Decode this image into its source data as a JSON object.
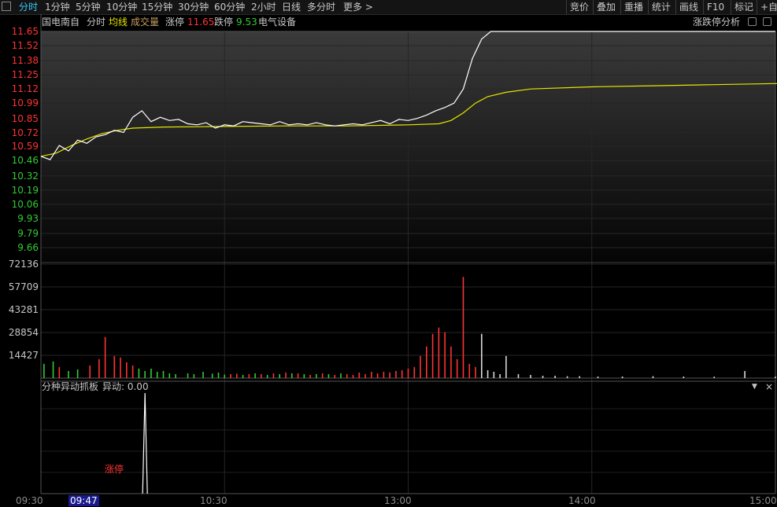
{
  "toolbar": {
    "tabs": [
      {
        "label": "分时",
        "active": true
      },
      {
        "label": "1分钟"
      },
      {
        "label": "5分钟"
      },
      {
        "label": "10分钟"
      },
      {
        "label": "15分钟"
      },
      {
        "label": "30分钟"
      },
      {
        "label": "60分钟"
      },
      {
        "label": "2小时"
      },
      {
        "label": "日线"
      },
      {
        "label": "多分时"
      },
      {
        "label": "更多 >"
      }
    ],
    "right_buttons": [
      "竞价",
      "叠加",
      "重播",
      "统计",
      "画线",
      "F10",
      "标记",
      "+自"
    ]
  },
  "header": {
    "stock_name": "国电南自",
    "mode": "分时",
    "avg_line": "均线",
    "volume": "成交量",
    "limit_up_label": "涨停",
    "limit_up_value": "11.65",
    "limit_down_label": "跌停",
    "limit_down_value": "9.53",
    "sector": "电气设备",
    "analysis_label": "涨跌停分析"
  },
  "indicator_panel": {
    "title": "分种异动抓板",
    "value_label": "异动: 0.00",
    "event_label": "涨停"
  },
  "colors": {
    "up": "#ff3333",
    "down": "#33cc33",
    "price_line": "#ffffff",
    "avg_line": "#e6e600",
    "highlight": "#33ccff"
  },
  "chart_data": {
    "type": "line",
    "price_axis": {
      "ticks": [
        "11.65",
        "11.52",
        "11.38",
        "11.25",
        "11.12",
        "10.99",
        "10.85",
        "10.72",
        "10.59",
        "10.46",
        "10.32",
        "10.19",
        "10.06",
        "9.93",
        "9.79",
        "9.66"
      ],
      "ylim": [
        9.6,
        11.7
      ]
    },
    "volume_axis": {
      "ticks": [
        "72136",
        "57709",
        "43281",
        "28854",
        "14427"
      ],
      "ylim": [
        0,
        72136
      ]
    },
    "time_ticks": [
      "09:30",
      "10:30",
      "13:00",
      "14:00",
      "15:00"
    ],
    "cursor_time": "09:47",
    "price_series": [
      [
        0,
        10.5
      ],
      [
        3,
        10.47
      ],
      [
        6,
        10.6
      ],
      [
        9,
        10.55
      ],
      [
        12,
        10.65
      ],
      [
        15,
        10.62
      ],
      [
        18,
        10.68
      ],
      [
        21,
        10.7
      ],
      [
        24,
        10.74
      ],
      [
        27,
        10.72
      ],
      [
        30,
        10.86
      ],
      [
        33,
        10.92
      ],
      [
        36,
        10.82
      ],
      [
        39,
        10.86
      ],
      [
        42,
        10.83
      ],
      [
        45,
        10.84
      ],
      [
        48,
        10.8
      ],
      [
        51,
        10.79
      ],
      [
        54,
        10.81
      ],
      [
        57,
        10.76
      ],
      [
        60,
        10.79
      ],
      [
        63,
        10.78
      ],
      [
        66,
        10.82
      ],
      [
        69,
        10.81
      ],
      [
        72,
        10.8
      ],
      [
        75,
        10.79
      ],
      [
        78,
        10.82
      ],
      [
        81,
        10.79
      ],
      [
        84,
        10.8
      ],
      [
        87,
        10.79
      ],
      [
        90,
        10.81
      ],
      [
        93,
        10.79
      ],
      [
        96,
        10.78
      ],
      [
        99,
        10.79
      ],
      [
        102,
        10.8
      ],
      [
        105,
        10.79
      ],
      [
        108,
        10.81
      ],
      [
        111,
        10.83
      ],
      [
        114,
        10.8
      ],
      [
        117,
        10.84
      ],
      [
        120,
        10.83
      ],
      [
        123,
        10.85
      ],
      [
        126,
        10.88
      ],
      [
        129,
        10.92
      ],
      [
        132,
        10.95
      ],
      [
        135,
        10.99
      ],
      [
        138,
        11.12
      ],
      [
        141,
        11.4
      ],
      [
        144,
        11.58
      ],
      [
        147,
        11.65
      ],
      [
        160,
        11.65
      ],
      [
        240,
        11.65
      ]
    ],
    "avg_series": [
      [
        0,
        10.5
      ],
      [
        5,
        10.53
      ],
      [
        10,
        10.6
      ],
      [
        15,
        10.66
      ],
      [
        20,
        10.71
      ],
      [
        25,
        10.74
      ],
      [
        30,
        10.76
      ],
      [
        40,
        10.77
      ],
      [
        60,
        10.775
      ],
      [
        80,
        10.78
      ],
      [
        100,
        10.78
      ],
      [
        120,
        10.79
      ],
      [
        130,
        10.8
      ],
      [
        134,
        10.83
      ],
      [
        138,
        10.9
      ],
      [
        142,
        10.99
      ],
      [
        146,
        11.05
      ],
      [
        152,
        11.09
      ],
      [
        160,
        11.12
      ],
      [
        180,
        11.14
      ],
      [
        200,
        11.15
      ],
      [
        220,
        11.16
      ],
      [
        240,
        11.17
      ],
      [
        260,
        11.18
      ],
      [
        280,
        11.19
      ],
      [
        300,
        11.2
      ],
      [
        320,
        11.205
      ],
      [
        340,
        11.21
      ],
      [
        360,
        11.215
      ],
      [
        369,
        11.22
      ],
      [
        372,
        11.25
      ],
      [
        390,
        11.26
      ],
      [
        420,
        11.265
      ],
      [
        445,
        11.27
      ]
    ],
    "volume_bars": [
      [
        1,
        9000,
        "down"
      ],
      [
        4,
        10500,
        "down"
      ],
      [
        6,
        7000,
        "up"
      ],
      [
        9,
        4500,
        "down"
      ],
      [
        12,
        5500,
        "down"
      ],
      [
        16,
        8000,
        "up"
      ],
      [
        19,
        12000,
        "up"
      ],
      [
        21,
        26000,
        "up"
      ],
      [
        24,
        14000,
        "up"
      ],
      [
        26,
        13000,
        "up"
      ],
      [
        28,
        10000,
        "up"
      ],
      [
        30,
        8000,
        "up"
      ],
      [
        32,
        6000,
        "down"
      ],
      [
        34,
        4500,
        "down"
      ],
      [
        36,
        6000,
        "down"
      ],
      [
        38,
        4000,
        "down"
      ],
      [
        40,
        4500,
        "down"
      ],
      [
        42,
        3000,
        "down"
      ],
      [
        44,
        2500,
        "down"
      ],
      [
        48,
        3000,
        "down"
      ],
      [
        50,
        2500,
        "down"
      ],
      [
        53,
        4000,
        "down"
      ],
      [
        56,
        2800,
        "down"
      ],
      [
        58,
        3500,
        "down"
      ],
      [
        60,
        2200,
        "down"
      ],
      [
        62,
        2500,
        "up"
      ],
      [
        64,
        2800,
        "up"
      ],
      [
        66,
        2000,
        "down"
      ],
      [
        68,
        2500,
        "up"
      ],
      [
        70,
        3000,
        "down"
      ],
      [
        72,
        2500,
        "up"
      ],
      [
        74,
        2000,
        "down"
      ],
      [
        76,
        3000,
        "up"
      ],
      [
        78,
        2500,
        "down"
      ],
      [
        80,
        3500,
        "up"
      ],
      [
        82,
        3000,
        "down"
      ],
      [
        84,
        3000,
        "up"
      ],
      [
        86,
        2500,
        "down"
      ],
      [
        88,
        2000,
        "up"
      ],
      [
        90,
        2500,
        "down"
      ],
      [
        92,
        3000,
        "up"
      ],
      [
        94,
        2500,
        "down"
      ],
      [
        96,
        2000,
        "up"
      ],
      [
        98,
        3000,
        "down"
      ],
      [
        100,
        2500,
        "up"
      ],
      [
        102,
        2000,
        "up"
      ],
      [
        104,
        3500,
        "up"
      ],
      [
        106,
        2500,
        "up"
      ],
      [
        108,
        4000,
        "up"
      ],
      [
        110,
        3000,
        "up"
      ],
      [
        112,
        4000,
        "up"
      ],
      [
        114,
        3500,
        "up"
      ],
      [
        116,
        4500,
        "up"
      ],
      [
        118,
        5000,
        "up"
      ],
      [
        120,
        6000,
        "up"
      ],
      [
        122,
        7000,
        "up"
      ],
      [
        124,
        14000,
        "up"
      ],
      [
        126,
        20000,
        "up"
      ],
      [
        128,
        28000,
        "up"
      ],
      [
        130,
        32000,
        "up"
      ],
      [
        132,
        29000,
        "up"
      ],
      [
        134,
        20000,
        "up"
      ],
      [
        136,
        12000,
        "up"
      ],
      [
        138,
        64000,
        "up"
      ],
      [
        140,
        9000,
        "up"
      ],
      [
        142,
        7000,
        "up"
      ],
      [
        144,
        28000,
        "neutral"
      ],
      [
        146,
        5000,
        "neutral"
      ],
      [
        148,
        4000,
        "neutral"
      ],
      [
        150,
        2500,
        "neutral"
      ],
      [
        152,
        14000,
        "neutral"
      ],
      [
        156,
        2500,
        "neutral"
      ],
      [
        160,
        2000,
        "neutral"
      ],
      [
        164,
        1500,
        "neutral"
      ],
      [
        168,
        1500,
        "neutral"
      ],
      [
        172,
        1200,
        "neutral"
      ],
      [
        176,
        1200,
        "neutral"
      ],
      [
        182,
        1000,
        "neutral"
      ],
      [
        190,
        1000,
        "neutral"
      ],
      [
        200,
        1200,
        "neutral"
      ],
      [
        210,
        1000,
        "neutral"
      ],
      [
        220,
        900,
        "neutral"
      ],
      [
        230,
        4500,
        "neutral"
      ],
      [
        240,
        900,
        "neutral"
      ],
      [
        260,
        800,
        "neutral"
      ],
      [
        280,
        1000,
        "neutral"
      ],
      [
        300,
        900,
        "neutral"
      ],
      [
        320,
        4000,
        "neutral"
      ],
      [
        340,
        900,
        "neutral"
      ],
      [
        360,
        800,
        "neutral"
      ],
      [
        365,
        1500,
        "neutral"
      ],
      [
        367,
        19000,
        "neutral"
      ],
      [
        368,
        34000,
        "neutral"
      ],
      [
        372,
        900,
        "neutral"
      ],
      [
        390,
        800,
        "neutral"
      ],
      [
        410,
        900,
        "neutral"
      ],
      [
        430,
        800,
        "neutral"
      ],
      [
        448,
        900,
        "neutral"
      ]
    ],
    "event_spike": {
      "minute": 34,
      "value": 1
    }
  }
}
